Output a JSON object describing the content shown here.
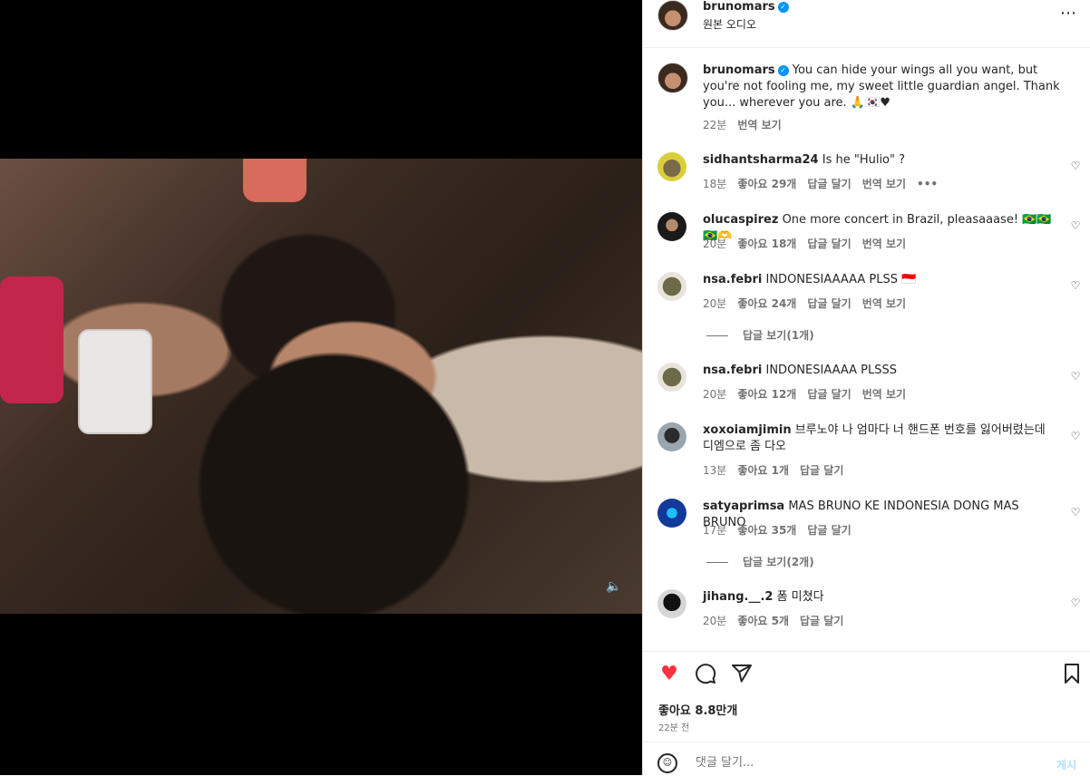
{
  "post": {
    "author": "brunomars",
    "audio": "원본 오디오",
    "caption": "You can hide your wings all you want, but you're not fooling me, my sweet little guardian angel. Thank you... wherever you are. 🙏🇰🇷♥",
    "caption_time": "22분",
    "translate": "번역 보기"
  },
  "comments": [
    {
      "user": "sidhantsharma24",
      "text": "Is he \"Hulio\" ?",
      "time": "18분",
      "likes": "좋아요 29개",
      "reply": "답글 달기",
      "translate": "번역 보기",
      "more": "•••"
    },
    {
      "user": "olucaspirez",
      "text": "One more concert in Brazil, pleasaaase! 🇧🇷🇧🇷🇧🇷🫶",
      "time": "20분",
      "likes": "좋아요 18개",
      "reply": "답글 달기",
      "translate": "번역 보기"
    },
    {
      "user": "nsa.febri",
      "text": "INDONESIAAAAA PLSS 🇮🇩",
      "time": "20분",
      "likes": "좋아요 24개",
      "reply": "답글 달기",
      "translate": "번역 보기",
      "view_replies": "답글 보기(1개)"
    },
    {
      "user": "nsa.febri",
      "text": "INDONESIAAAA PLSSS",
      "time": "20분",
      "likes": "좋아요 12개",
      "reply": "답글 달기",
      "translate": "번역 보기"
    },
    {
      "user": "xoxoiamjimin",
      "text": "브루노야 나 엄마다 너 핸드폰 번호를 잃어버렸는데 디엠으로 좀 다오",
      "time": "13분",
      "likes": "좋아요 1개",
      "reply": "답글 달기"
    },
    {
      "user": "satyaprimsa",
      "text": "MAS BRUNO KE INDONESIA DONG MAS BRUNO",
      "time": "17분",
      "likes": "좋아요 35개",
      "reply": "답글 달기",
      "view_replies": "답글 보기(2개)"
    },
    {
      "user": "jihang.__.2",
      "text": "폼 미쳤다",
      "time": "20분",
      "likes": "좋아요 5개",
      "reply": "답글 달기"
    }
  ],
  "footer": {
    "likes": "좋아요 8.8만개",
    "ago": "22분 전",
    "placeholder": "댓글 달기...",
    "post_label": "게시",
    "like_color": "#ff3040"
  },
  "icons": {
    "verified": "✓",
    "more": "⋯",
    "heart_small": "♡",
    "heart_filled": "♥",
    "comment": "◯",
    "share": "➤",
    "save": "🔖",
    "emoji": "☺",
    "speaker": "🔈"
  }
}
